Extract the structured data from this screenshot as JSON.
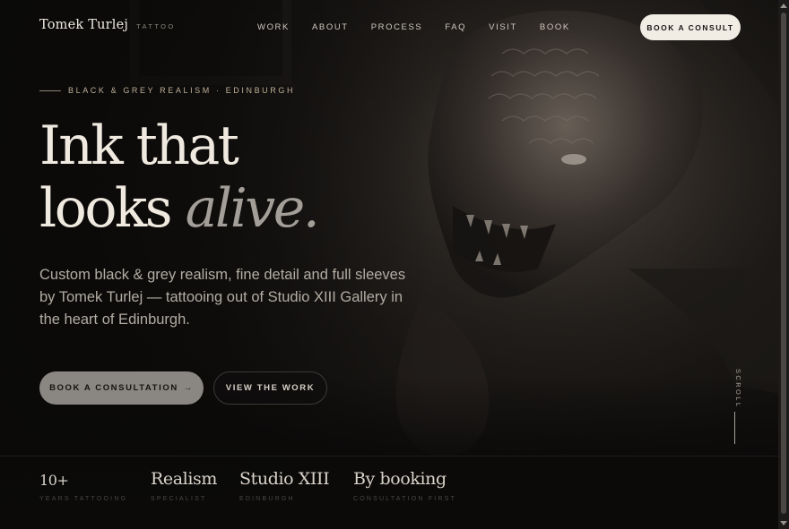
{
  "header": {
    "brand_name": "Tomek Turlej",
    "brand_tag": "TATTOO",
    "nav": [
      "WORK",
      "ABOUT",
      "PROCESS",
      "FAQ",
      "VISIT",
      "BOOK"
    ],
    "cta_label": "BOOK A CONSULT"
  },
  "hero": {
    "eyebrow": "BLACK & GREY REALISM · EDINBURGH",
    "headline_line1": "Ink that",
    "headline_line2": "looks ",
    "headline_accent": "alive.",
    "lede": "Custom black & grey realism, fine detail and full sleeves by Tomek Turlej — tattooing out of Studio XIII Gallery in the heart of Edinburgh.",
    "primary_label": "BOOK A CONSULTATION",
    "primary_arrow": "→",
    "secondary_label": "VIEW THE WORK",
    "scroll_label": "SCROLL"
  },
  "stats": [
    {
      "value": "10+",
      "label": "YEARS TATTOOING"
    },
    {
      "value": "Realism",
      "label": "SPECIALIST"
    },
    {
      "value": "Studio XIII",
      "label": "EDINBURGH"
    },
    {
      "value": "By booking",
      "label": "CONSULTATION FIRST"
    }
  ],
  "colors": {
    "background": "#0b0a09",
    "text": "#efe9df",
    "accent_gold": "#bdae96",
    "cta_fill": "#f1ede5",
    "primary_button": "#8a8782"
  },
  "icons": {
    "arrow": "right-arrow-icon"
  }
}
